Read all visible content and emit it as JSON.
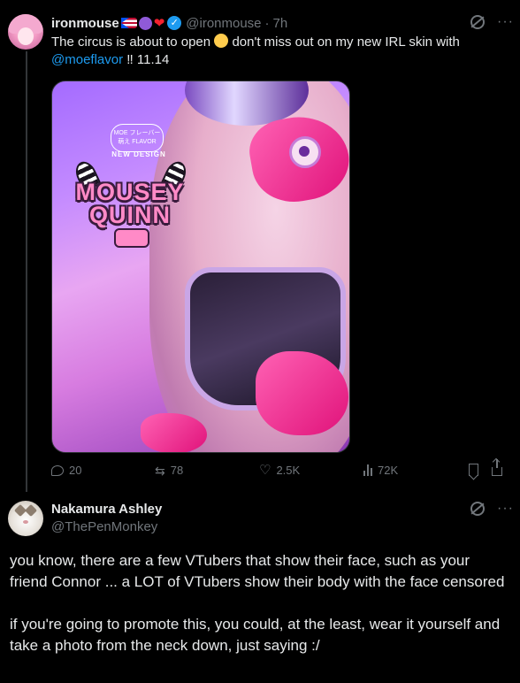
{
  "tweet": {
    "name": "ironmouse",
    "handle": "@ironmouse",
    "separator": "·",
    "time": "7h",
    "text_before_emoji": "The circus is about to open",
    "text_after_emoji": "don't miss out on my new IRL skin with",
    "mention": "@moeflavor",
    "text_tail": "‼ 11.14",
    "media": {
      "logo_small": "MOE フレーバー 萌え FLAVOR",
      "logo_tag": "NEW DESIGN",
      "logo_title_1": "MOUSEY",
      "logo_title_2": "QUINN"
    },
    "actions": {
      "replies": "20",
      "reposts": "78",
      "likes": "2.5K",
      "views": "72K"
    }
  },
  "reply": {
    "name": "Nakamura Ashley",
    "handle": "@ThePenMonkey",
    "paragraph_1": "you know, there are a few VTubers that show their face, such as your friend Connor ... a LOT of VTubers show their body with the face censored",
    "paragraph_2": "if you're going to promote this, you could, at the least, wear it yourself and take a photo from the neck down, just saying :/"
  },
  "colors": {
    "background": "#000000",
    "text": "#e7e9ea",
    "muted": "#71767b",
    "link": "#1d9bf0"
  },
  "icons": [
    "verified-badge-icon",
    "grok-icon",
    "more-icon",
    "reply-icon",
    "repost-icon",
    "like-icon",
    "views-icon",
    "bookmark-icon",
    "share-icon"
  ]
}
